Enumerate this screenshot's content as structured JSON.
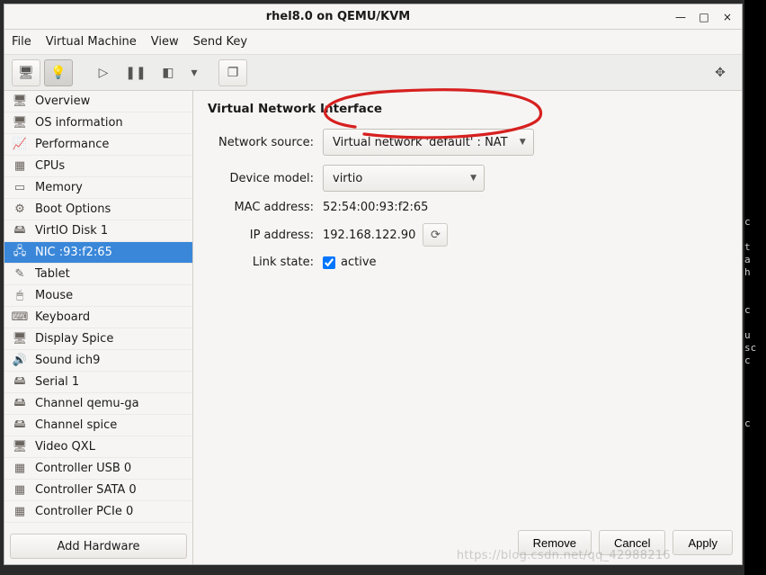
{
  "window": {
    "title": "rhel8.0 on QEMU/KVM",
    "minimize": "—",
    "maximize": "□",
    "close": "×"
  },
  "menu": {
    "file": "File",
    "vm": "Virtual Machine",
    "view": "View",
    "sendkey": "Send Key"
  },
  "sidebar": {
    "items": [
      {
        "label": "Overview",
        "icon": "🖥"
      },
      {
        "label": "OS information",
        "icon": "🖥"
      },
      {
        "label": "Performance",
        "icon": "📈"
      },
      {
        "label": "CPUs",
        "icon": "▦"
      },
      {
        "label": "Memory",
        "icon": "▭"
      },
      {
        "label": "Boot Options",
        "icon": "⚙"
      },
      {
        "label": "VirtIO Disk 1",
        "icon": "🖴"
      },
      {
        "label": "NIC :93:f2:65",
        "icon": "🖧"
      },
      {
        "label": "Tablet",
        "icon": "✎"
      },
      {
        "label": "Mouse",
        "icon": "🖱"
      },
      {
        "label": "Keyboard",
        "icon": "⌨"
      },
      {
        "label": "Display Spice",
        "icon": "🖥"
      },
      {
        "label": "Sound ich9",
        "icon": "🔊"
      },
      {
        "label": "Serial 1",
        "icon": "🖴"
      },
      {
        "label": "Channel qemu-ga",
        "icon": "🖴"
      },
      {
        "label": "Channel spice",
        "icon": "🖴"
      },
      {
        "label": "Video QXL",
        "icon": "🖥"
      },
      {
        "label": "Controller USB 0",
        "icon": "▦"
      },
      {
        "label": "Controller SATA 0",
        "icon": "▦"
      },
      {
        "label": "Controller PCIe 0",
        "icon": "▦"
      }
    ],
    "add_hardware": "Add Hardware"
  },
  "detail": {
    "heading": "Virtual Network Interface",
    "rows": {
      "network_source_label": "Network source:",
      "network_source_value": "Virtual network 'default' : NAT",
      "device_model_label": "Device model:",
      "device_model_value": "virtio",
      "mac_label": "MAC address:",
      "mac_value": "52:54:00:93:f2:65",
      "ip_label": "IP address:",
      "ip_value": "192.168.122.90",
      "linkstate_label": "Link state:",
      "linkstate_active": "active"
    }
  },
  "footer": {
    "remove": "Remove",
    "cancel": "Cancel",
    "apply": "Apply"
  },
  "watermark": "https://blog.csdn.net/qq_42988216"
}
